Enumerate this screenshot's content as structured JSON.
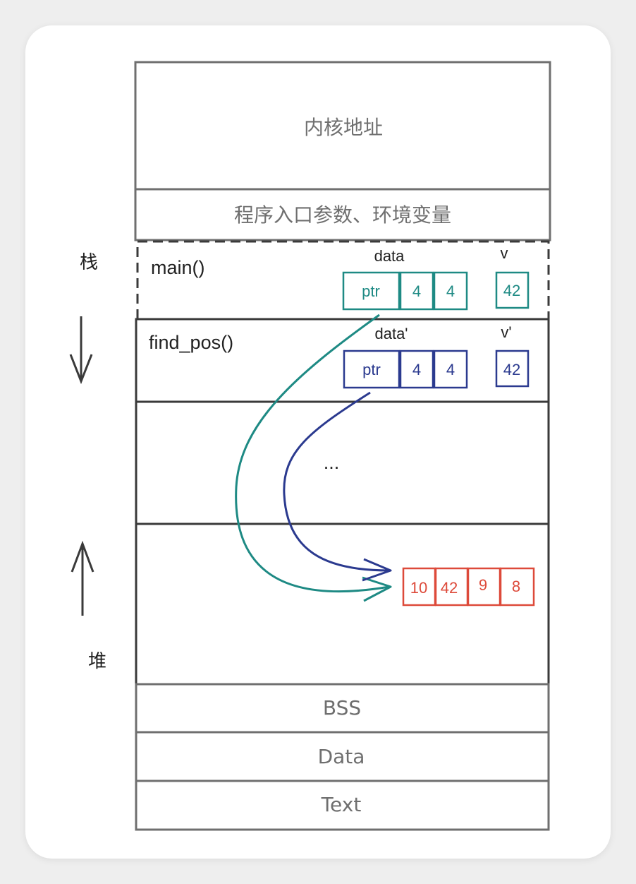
{
  "diagram": {
    "regions": {
      "kernel": "内核地址",
      "env": "程序入口参数、环境变量",
      "gap": "...",
      "bss": "BSS",
      "data": "Data",
      "text": "Text"
    },
    "side_labels": {
      "stack": "栈",
      "heap": "堆"
    },
    "frames": {
      "main": {
        "name": "main()",
        "var_data_label": "data",
        "var_v_label": "v",
        "cells": [
          "ptr",
          "4",
          "4"
        ],
        "v_value": "42"
      },
      "find_pos": {
        "name": "find_pos()",
        "var_data_label": "data'",
        "var_v_label": "v'",
        "cells": [
          "ptr",
          "4",
          "4"
        ],
        "v_value": "42"
      }
    },
    "heap_cells": [
      "10",
      "42",
      "9",
      "8"
    ],
    "colors": {
      "main_frame": "#1e8a84",
      "find_pos_frame": "#2b3a8f",
      "heap_array": "#dd4a3a",
      "region_border": "#6f6f6f",
      "stack_border": "#3a3a3a"
    }
  }
}
